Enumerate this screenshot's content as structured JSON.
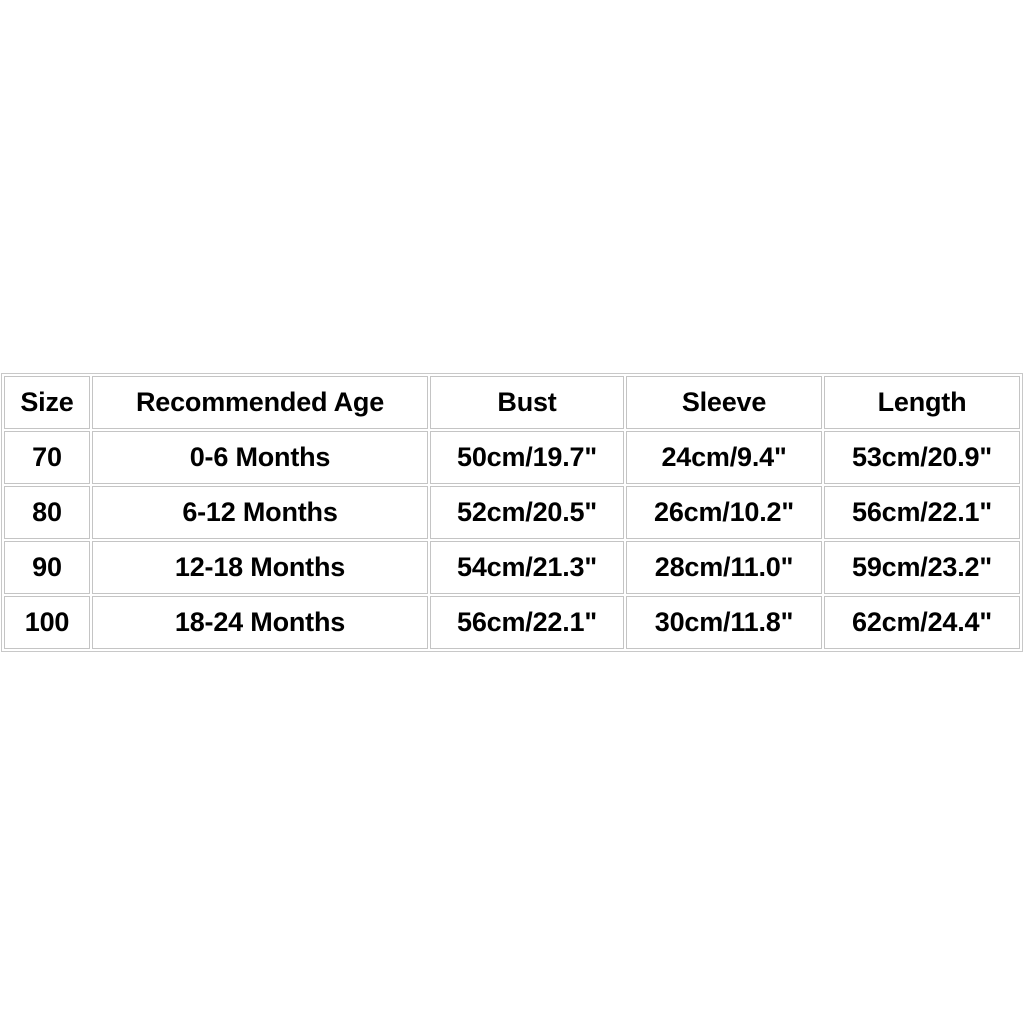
{
  "page": {
    "background_color": "#ffffff",
    "text_color": "#000000",
    "border_color": "#c4c4c4"
  },
  "size_chart": {
    "headers": [
      "Size",
      "Recommended Age",
      "Bust",
      "Sleeve",
      "Length"
    ],
    "rows": [
      {
        "size": "70",
        "age": "0-6 Months",
        "bust": "50cm/19.7\"",
        "sleeve": "24cm/9.4\"",
        "length": "53cm/20.9\""
      },
      {
        "size": "80",
        "age": "6-12 Months",
        "bust": "52cm/20.5\"",
        "sleeve": "26cm/10.2\"",
        "length": "56cm/22.1\""
      },
      {
        "size": "90",
        "age": "12-18 Months",
        "bust": "54cm/21.3\"",
        "sleeve": "28cm/11.0\"",
        "length": "59cm/23.2\""
      },
      {
        "size": "100",
        "age": "18-24 Months",
        "bust": "56cm/22.1\"",
        "sleeve": "30cm/11.8\"",
        "length": "62cm/24.4\""
      }
    ]
  }
}
